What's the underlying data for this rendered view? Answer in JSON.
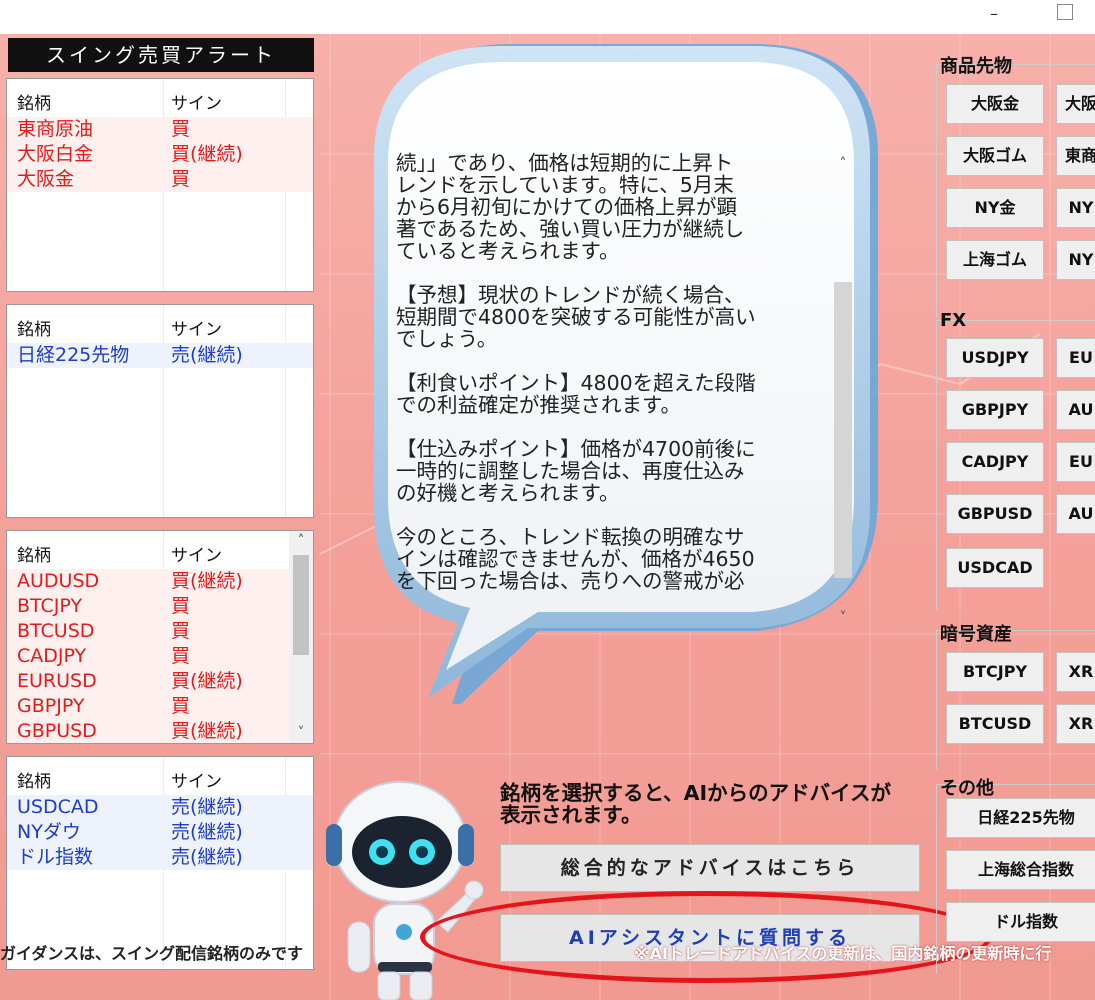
{
  "window": {
    "minimize_glyph": "–"
  },
  "left": {
    "title": "スイング売買アラート",
    "col_name": "銘柄",
    "col_sign": "サイン",
    "panel1": [
      {
        "name": "東商原油",
        "sign": "買"
      },
      {
        "name": "大阪白金",
        "sign": "買(継続)"
      },
      {
        "name": "大阪金",
        "sign": "買"
      }
    ],
    "panel2": [
      {
        "name": "日経225先物",
        "sign": "売(継続)"
      }
    ],
    "panel3": [
      {
        "name": "AUDUSD",
        "sign": "買(継続)"
      },
      {
        "name": "BTCJPY",
        "sign": "買"
      },
      {
        "name": "BTCUSD",
        "sign": "買"
      },
      {
        "name": "CADJPY",
        "sign": "買"
      },
      {
        "name": "EURUSD",
        "sign": "買(継続)"
      },
      {
        "name": "GBPJPY",
        "sign": "買"
      },
      {
        "name": "GBPUSD",
        "sign": "買(継続)"
      }
    ],
    "panel4": [
      {
        "name": "USDCAD",
        "sign": "売(継続)"
      },
      {
        "name": "NYダウ",
        "sign": "売(継続)"
      },
      {
        "name": "ドル指数",
        "sign": "売(継続)"
      }
    ],
    "footer": "ガイダンスは、スイング配信銘柄のみです"
  },
  "bubble": {
    "lines": [
      "続」」であり、価格は短期的に上昇ト",
      "レンドを示しています。特に、5月末",
      "から6月初旬にかけての価格上昇が顕",
      "著であるため、強い買い圧力が継続し",
      "ていると考えられます。",
      "",
      "【予想】現状のトレンドが続く場合、",
      "短期間で4800を突破する可能性が高い",
      "でしょう。",
      "",
      "【利食いポイント】4800を超えた段階",
      "での利益確定が推奨されます。",
      "",
      "【仕込みポイント】価格が4700前後に",
      "一時的に調整した場合は、再度仕込み",
      "の好機と考えられます。",
      "",
      "今のところ、トレンド転換の明確なサ",
      "インは確認できませんが、価格が4650",
      "を下回った場合は、売りへの警戒が必"
    ],
    "scroll_up": "˄",
    "scroll_down": "˅"
  },
  "center": {
    "hint_line1": "銘柄を選択すると、AIからのアドバイスが",
    "hint_line2": "表示されます。",
    "general_button": "総合的なアドバイスはこちら",
    "ai_button": "AIアシスタントに質問する",
    "footer": "※AIトレードアドバイスの更新は、国内銘柄の更新時に行"
  },
  "right": {
    "commodities_label": "商品先物",
    "commodities": [
      "大阪金",
      "大阪",
      "大阪ゴム",
      "東商",
      "NY金",
      "NY",
      "上海ゴム",
      "NY"
    ],
    "fx_label": "FX",
    "fx": [
      "USDJPY",
      "EU",
      "GBPJPY",
      "AU",
      "CADJPY",
      "EU",
      "GBPUSD",
      "AU",
      "USDCAD"
    ],
    "crypto_label": "暗号資産",
    "crypto": [
      "BTCJPY",
      "XR",
      "BTCUSD",
      "XR"
    ],
    "other_label": "その他",
    "other": [
      "日経225先物",
      "上海総合指数",
      "ドル指数"
    ]
  },
  "colors": {
    "buy": "#e31b1b",
    "sell": "#1e3cc8",
    "background": "#f4a19a",
    "highlight_ellipse": "#e3151b"
  }
}
